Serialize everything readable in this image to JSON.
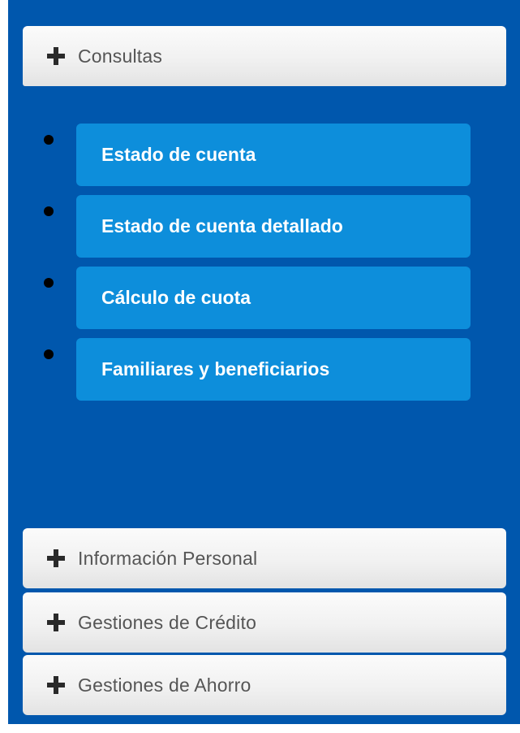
{
  "sections": [
    {
      "label": "Consultas",
      "icon": "plus-icon",
      "expanded": true
    },
    {
      "label": "Información Personal",
      "icon": "plus-icon",
      "expanded": false
    },
    {
      "label": "Gestiones de Crédito",
      "icon": "plus-icon",
      "expanded": false
    },
    {
      "label": "Gestiones de Ahorro",
      "icon": "plus-icon",
      "expanded": false
    }
  ],
  "consultas_items": [
    {
      "label": "Estado de cuenta"
    },
    {
      "label": "Estado de cuenta detallado"
    },
    {
      "label": "Cálculo de cuota"
    },
    {
      "label": "Familiares y beneficiarios"
    }
  ],
  "colors": {
    "panel_background": "#0057ad",
    "submenu_button": "#0d8edb",
    "header_background": "#f1f1f1",
    "header_text": "#555555"
  }
}
